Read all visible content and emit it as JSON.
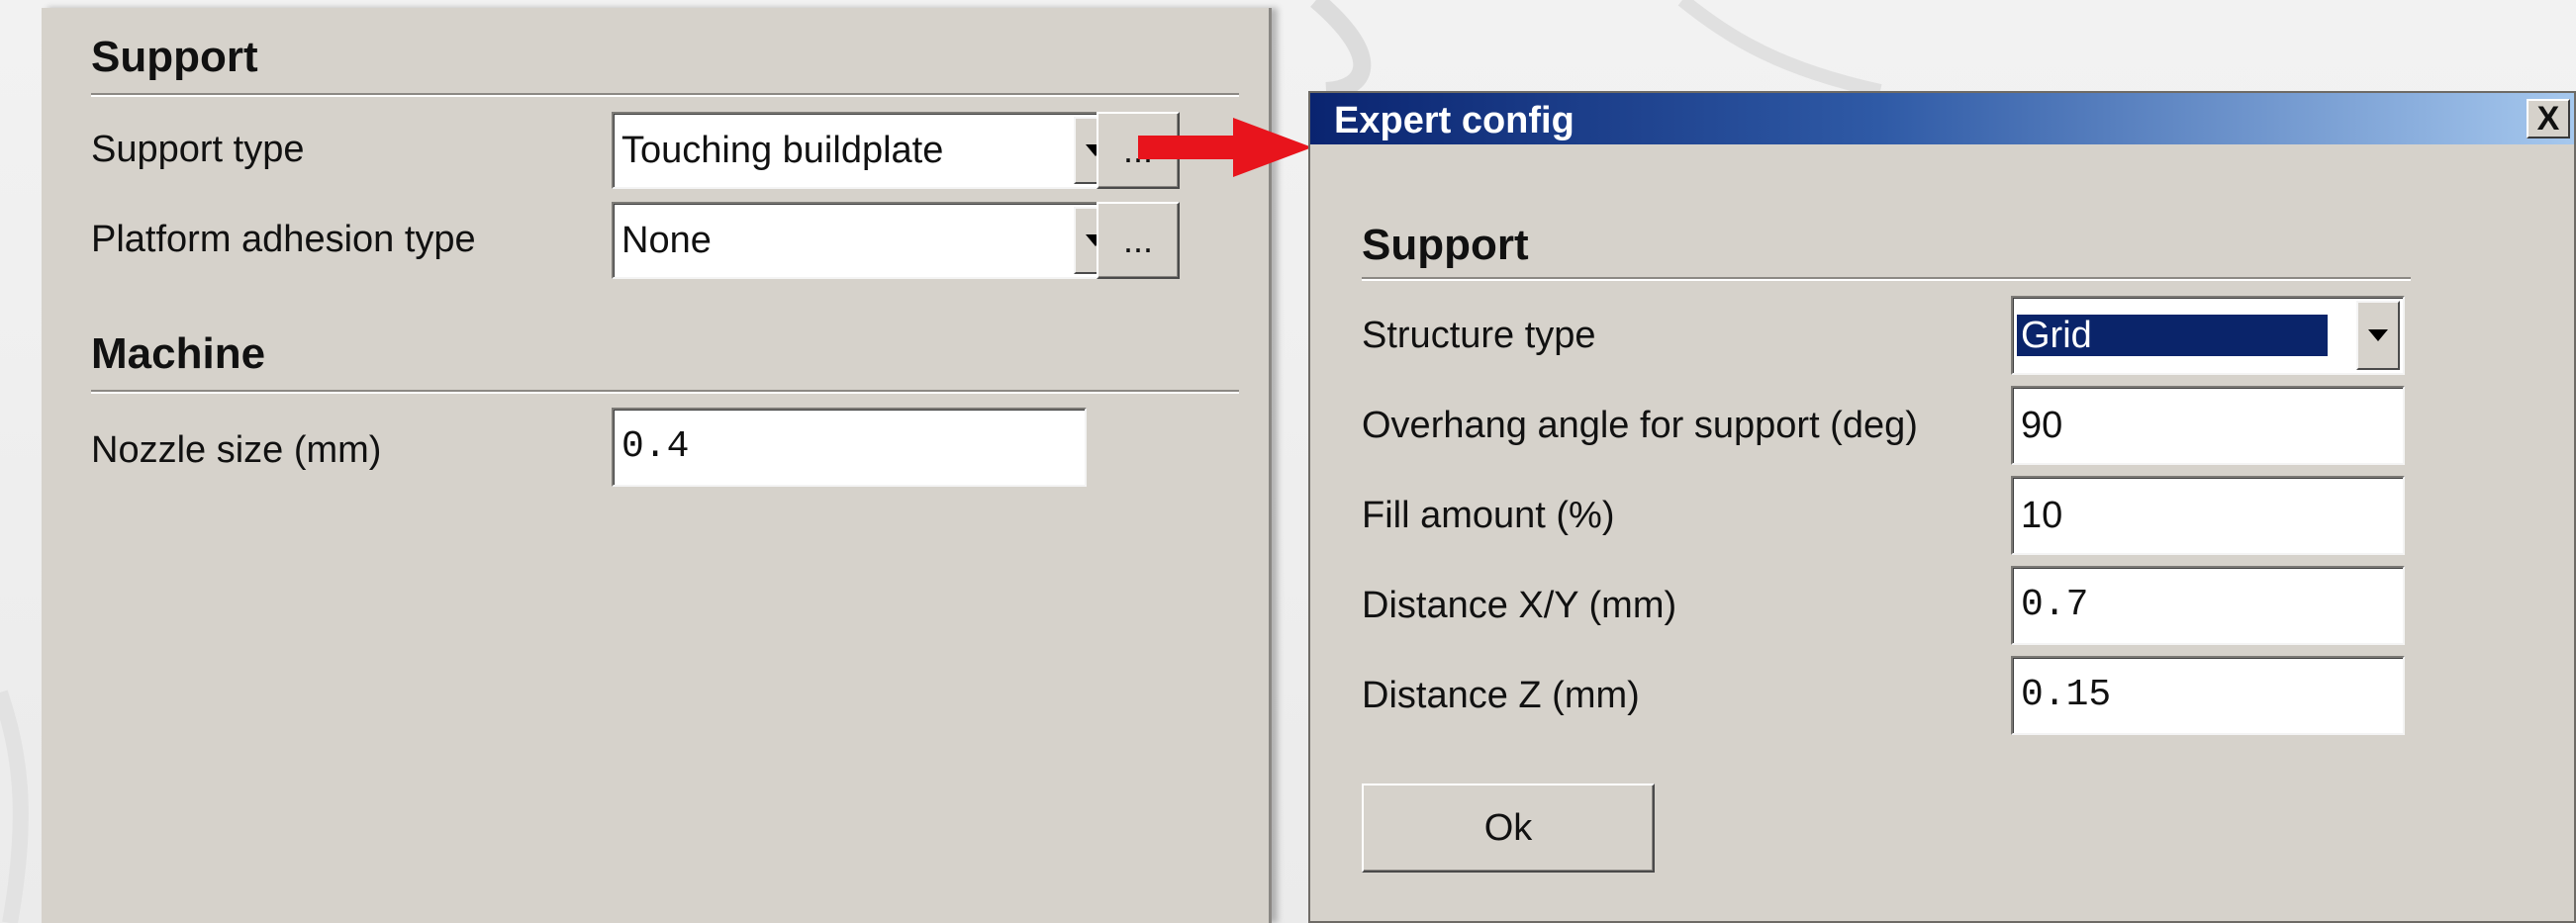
{
  "settings_panel": {
    "support_section": {
      "title": "Support",
      "support_type_label": "Support type",
      "support_type_value": "Touching buildplate",
      "adhesion_label": "Platform adhesion type",
      "adhesion_value": "None",
      "more_button_label": "..."
    },
    "machine_section": {
      "title": "Machine",
      "nozzle_label": "Nozzle size (mm)",
      "nozzle_value": "0.4"
    }
  },
  "expert_dialog": {
    "title": "Expert config",
    "close_label": "X",
    "section_title": "Support",
    "structure_type_label": "Structure type",
    "structure_type_value": "Grid",
    "overhang_label": "Overhang angle for support (deg)",
    "overhang_value": "90",
    "fill_label": "Fill amount (%)",
    "fill_value": "10",
    "distance_xy_label": "Distance X/Y (mm)",
    "distance_xy_value": "0.7",
    "distance_z_label": "Distance Z (mm)",
    "distance_z_value": "0.15",
    "ok_label": "Ok"
  },
  "colors": {
    "titlebar_start": "#0a2470",
    "titlebar_end": "#a6c8ee",
    "arrow": "#e8141c",
    "panel_bg": "#d6d2cb",
    "selection": "#0a246a"
  }
}
